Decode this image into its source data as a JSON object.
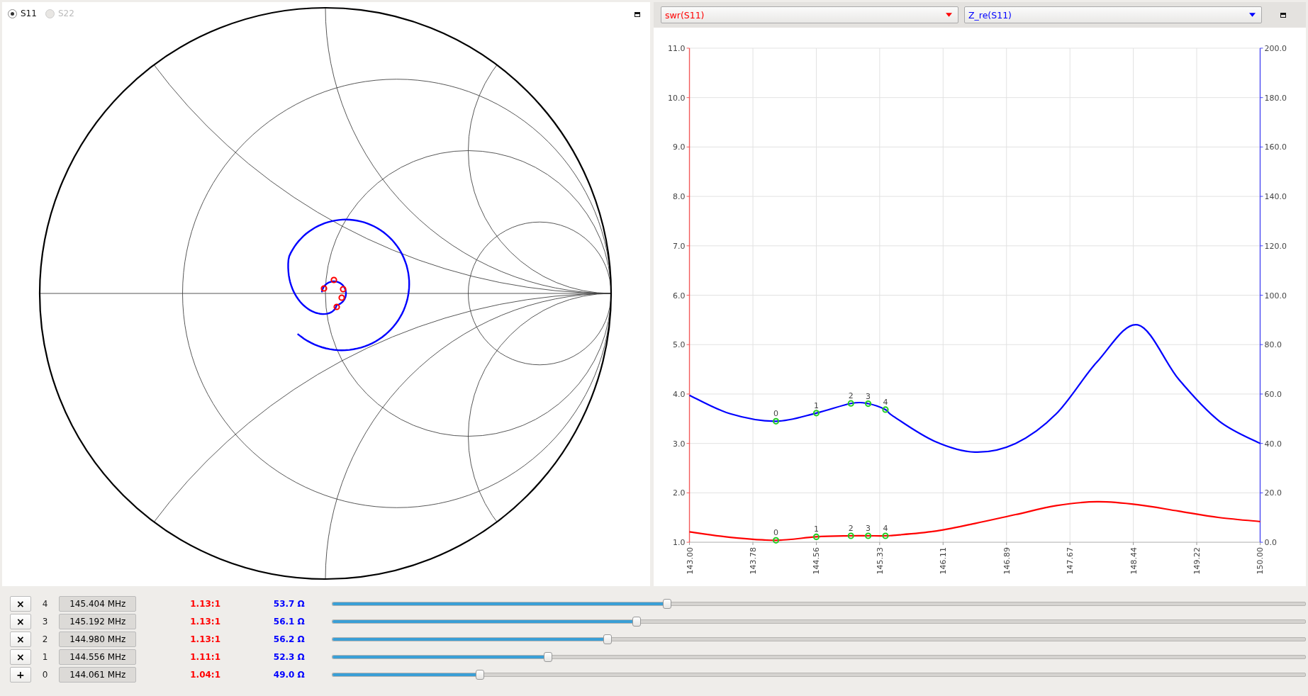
{
  "smith": {
    "ports": [
      {
        "label": "S11",
        "selected": true,
        "disabled": false
      },
      {
        "label": "S22",
        "selected": false,
        "disabled": true
      }
    ]
  },
  "chart": {
    "chart_data": {
      "type": "line",
      "x": [
        143.0,
        143.5,
        144.061,
        144.556,
        144.98,
        145.192,
        145.404,
        145.5,
        146.0,
        146.5,
        147.0,
        147.5,
        148.0,
        148.5,
        149.0,
        149.5,
        150.0
      ],
      "series": [
        {
          "name": "swr(S11)",
          "color": "#ff0000",
          "values": [
            1.21,
            1.1,
            1.04,
            1.11,
            1.13,
            1.13,
            1.13,
            1.14,
            1.22,
            1.38,
            1.56,
            1.74,
            1.82,
            1.76,
            1.63,
            1.5,
            1.42
          ]
        },
        {
          "name": "Z_re(S11)",
          "color": "#0000ff",
          "axis": "y2",
          "values": [
            59.5,
            52,
            49.0,
            52.3,
            56.2,
            56.1,
            53.7,
            51,
            41,
            36.5,
            40,
            52,
            73,
            88,
            66,
            49,
            40
          ]
        },
        {
          "type": "scatter",
          "color": "#22cc22",
          "values": [
            null,
            null,
            1.04,
            1.11,
            1.13,
            1.13,
            1.13,
            null,
            null,
            null,
            null,
            null,
            null,
            null,
            null,
            null,
            null
          ]
        },
        {
          "type": "scatter",
          "color": "#22cc22",
          "axis": "y2",
          "values": [
            null,
            null,
            49.0,
            52.3,
            56.2,
            56.1,
            53.7,
            null,
            null,
            null,
            null,
            null,
            null,
            null,
            null,
            null,
            null
          ]
        }
      ],
      "grid": true,
      "xlim": [
        143.0,
        150.0
      ],
      "ylim": [
        1.0,
        11.0
      ],
      "y2lim": [
        0,
        200
      ],
      "xticks": [
        {
          "value": 143.0,
          "label": "143.00"
        },
        {
          "value": 143.778,
          "label": "143.78"
        },
        {
          "value": 144.556,
          "label": "144.56"
        },
        {
          "value": 145.333,
          "label": "145.33"
        },
        {
          "value": 146.111,
          "label": "146.11"
        },
        {
          "value": 146.889,
          "label": "146.89"
        },
        {
          "value": 147.667,
          "label": "147.67"
        },
        {
          "value": 148.444,
          "label": "148.44"
        },
        {
          "value": 149.222,
          "label": "149.22"
        },
        {
          "value": 150.0,
          "label": "150.00"
        }
      ],
      "yticks": [
        {
          "value": 1,
          "label": "1.0"
        },
        {
          "value": 2,
          "label": "2.0"
        },
        {
          "value": 3,
          "label": "3.0"
        },
        {
          "value": 4,
          "label": "4.0"
        },
        {
          "value": 5,
          "label": "5.0"
        },
        {
          "value": 6,
          "label": "6.0"
        },
        {
          "value": 7,
          "label": "7.0"
        },
        {
          "value": 8,
          "label": "8.0"
        },
        {
          "value": 9,
          "label": "9.0"
        },
        {
          "value": 10,
          "label": "10.0"
        },
        {
          "value": 11,
          "label": "11.0"
        }
      ],
      "y2ticks": [
        {
          "value": 0,
          "label": "0.0"
        },
        {
          "value": 20,
          "label": "20.0"
        },
        {
          "value": 40,
          "label": "40.0"
        },
        {
          "value": 60,
          "label": "60.0"
        },
        {
          "value": 80,
          "label": "80.0"
        },
        {
          "value": 100,
          "label": "100.0"
        },
        {
          "value": 120,
          "label": "120.0"
        },
        {
          "value": 140,
          "label": "140.0"
        },
        {
          "value": 160,
          "label": "160.0"
        },
        {
          "value": 180,
          "label": "180.0"
        },
        {
          "value": 200,
          "label": "200.0"
        }
      ],
      "annotations": [
        "0",
        "1",
        "2",
        "3",
        "4",
        "0",
        "1",
        "2",
        "3",
        "4"
      ]
    }
  },
  "markers": [
    {
      "button": "×",
      "index": "4",
      "frequency": "145.404 MHz",
      "swr": "1.13:1",
      "impedance": "53.7 Ω",
      "level": 0.344
    },
    {
      "button": "×",
      "index": "3",
      "frequency": "145.192 MHz",
      "swr": "1.13:1",
      "impedance": "56.1 Ω",
      "level": 0.313
    },
    {
      "button": "×",
      "index": "2",
      "frequency": "144.980 MHz",
      "swr": "1.13:1",
      "impedance": "56.2 Ω",
      "level": 0.283
    },
    {
      "button": "×",
      "index": "1",
      "frequency": "144.556 MHz",
      "swr": "1.11:1",
      "impedance": "52.3 Ω",
      "level": 0.222
    },
    {
      "button": "+",
      "index": "0",
      "frequency": "144.061 MHz",
      "swr": "1.04:1",
      "impedance": "49.0 Ω",
      "level": 0.152
    }
  ]
}
